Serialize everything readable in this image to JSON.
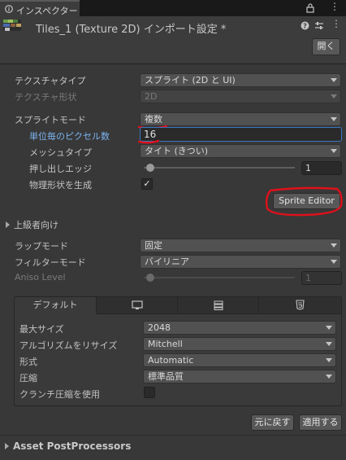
{
  "tab": {
    "label": "インスペクター *",
    "icon": "info-icon"
  },
  "header": {
    "title": "Tiles_1 (Texture 2D) インポート設定 *",
    "open_label": "開く"
  },
  "texture_type": {
    "label": "テクスチャタイプ",
    "value": "スプライト (2D と UI)"
  },
  "texture_shape": {
    "label": "テクスチャ形状",
    "value": "2D"
  },
  "sprite_mode": {
    "label": "スプライトモード",
    "value": "複数"
  },
  "pixels_per_unit": {
    "label": "単位毎のピクセル数",
    "value": "16"
  },
  "mesh_type": {
    "label": "メッシュタイプ",
    "value": "タイト (きつい)"
  },
  "extrude_edges": {
    "label": "押し出しエッジ",
    "value": "1",
    "level": 0.0
  },
  "generate_physics": {
    "label": "物理形状を生成",
    "checked": true
  },
  "sprite_editor_label": "Sprite Editor",
  "advanced_label": "上級者向け",
  "wrap_mode": {
    "label": "ラップモード",
    "value": "固定"
  },
  "filter_mode": {
    "label": "フィルターモード",
    "value": "バイリニア"
  },
  "aniso_level": {
    "label": "Aniso Level",
    "value": "1",
    "level": 0.0
  },
  "platform": {
    "tabs": [
      {
        "label": "デフォルト",
        "icon": ""
      },
      {
        "label": "",
        "icon": "monitor-icon"
      },
      {
        "label": "",
        "icon": "server-icon"
      },
      {
        "label": "",
        "icon": "html5-icon"
      }
    ],
    "max_size": {
      "label": "最大サイズ",
      "value": "2048"
    },
    "resize_algorithm": {
      "label": "アルゴリズムをリサイズ",
      "value": "Mitchell"
    },
    "format": {
      "label": "形式",
      "value": "Automatic"
    },
    "compression": {
      "label": "圧縮",
      "value": "標準品質"
    },
    "crunch": {
      "label": "クランチ圧縮を使用",
      "checked": false
    }
  },
  "revert_label": "元に戻す",
  "apply_label": "適用する",
  "asset_postprocessors_label": "Asset PostProcessors",
  "colors": {
    "annotation_red": "#e0101a",
    "focus_blue": "#3a78c2",
    "label_blue": "#7bb3ef"
  }
}
